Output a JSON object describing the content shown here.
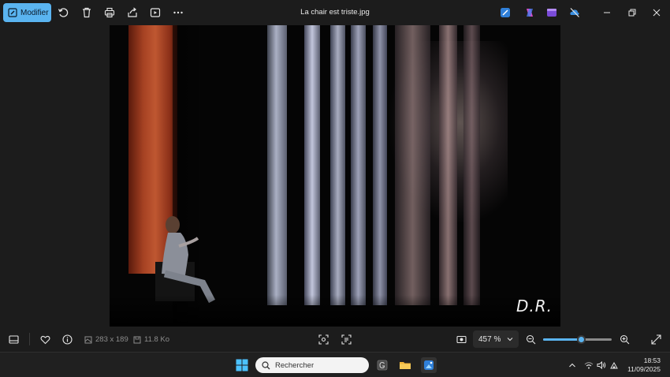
{
  "window": {
    "title": "La chair est triste.jpg"
  },
  "toolbar": {
    "modify_label": "Modifier",
    "actions": [
      "rotate-icon",
      "delete-icon",
      "print-icon",
      "share-icon",
      "slideshow-icon",
      "more-icon"
    ],
    "app_icons": [
      "photos-edit-icon",
      "copilot-icon",
      "clipchamp-icon",
      "onedrive-off-icon"
    ],
    "window_controls": [
      "minimize-icon",
      "restore-icon",
      "close-icon"
    ]
  },
  "image": {
    "watermark": "D.R."
  },
  "statusbar": {
    "dimensions": "283 x 189",
    "file_size": "11.8 Ko",
    "zoom_value": "457 %",
    "zoom_fraction": 0.56
  },
  "taskbar": {
    "search_placeholder": "Rechercher",
    "time": "18:53",
    "date": "11/09/2025"
  },
  "colors": {
    "accent": "#5ab4f0",
    "background": "#1c1c1c",
    "taskbar": "#202020"
  }
}
